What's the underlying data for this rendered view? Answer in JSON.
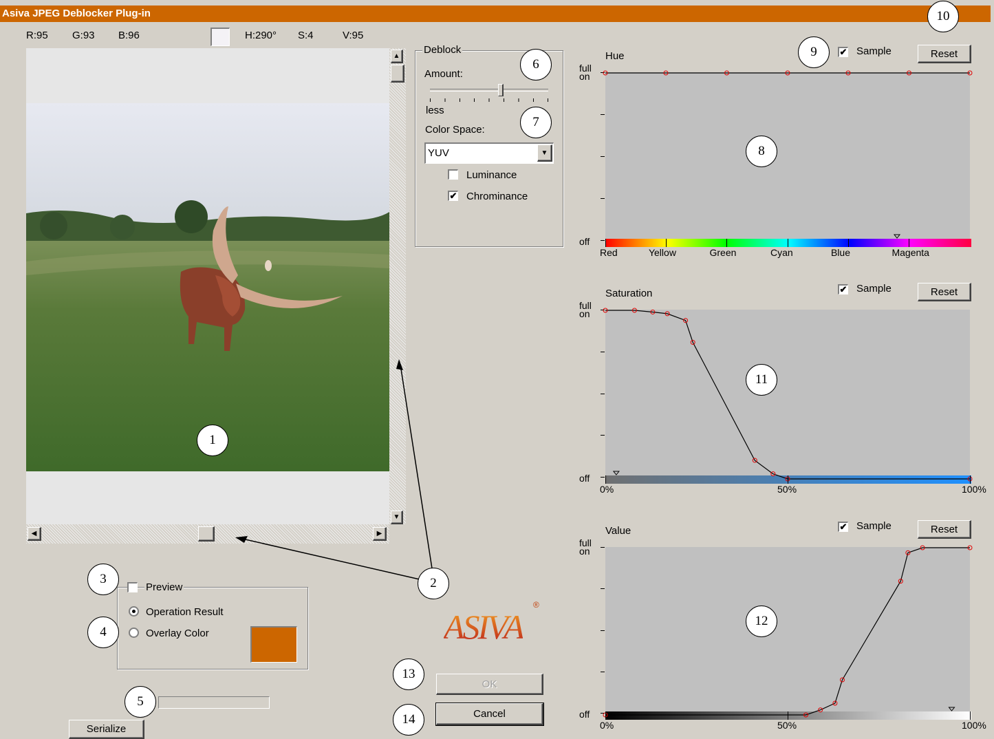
{
  "window": {
    "title": "Asiva JPEG Deblocker Plug-in"
  },
  "readout": {
    "r": "R:95",
    "g": "G:93",
    "b": "B:96",
    "h": "H:290°",
    "s": "S:4",
    "v": "V:95",
    "swatch_color": "#f4f2f6"
  },
  "deblock": {
    "group_label": "Deblock",
    "amount_label": "Amount:",
    "amount_min_label": "less",
    "amount_level": 0.6,
    "color_space_label": "Color Space:",
    "color_space_value": "YUV",
    "luminance_label": "Luminance",
    "luminance_checked": false,
    "chrominance_label": "Chrominance",
    "chrominance_checked": true
  },
  "preview": {
    "group_label": "Preview",
    "checked": false,
    "operation_result_label": "Operation Result",
    "overlay_color_label": "Overlay Color",
    "selected": "operation_result",
    "overlay_color": "#cc6600"
  },
  "buttons": {
    "serialize": "Serialize",
    "ok": "OK",
    "cancel": "Cancel"
  },
  "logo": {
    "text": "ASIVA",
    "mark": "®"
  },
  "graphs": {
    "hue": {
      "title": "Hue",
      "sample_label": "Sample",
      "sample_checked": true,
      "reset_label": "Reset",
      "y_top_label_1": "full",
      "y_top_label_2": "on",
      "y_bottom_label": "off",
      "x_labels": [
        "Red",
        "Yellow",
        "Green",
        "Cyan",
        "Blue",
        "Magenta"
      ],
      "curve": [
        [
          0,
          1
        ],
        [
          0.166,
          1
        ],
        [
          0.333,
          1
        ],
        [
          0.5,
          1
        ],
        [
          0.666,
          1
        ],
        [
          0.833,
          1
        ],
        [
          1,
          1
        ]
      ],
      "marker": 0.8
    },
    "saturation": {
      "title": "Saturation",
      "sample_label": "Sample",
      "sample_checked": true,
      "reset_label": "Reset",
      "y_top_label_1": "full",
      "y_top_label_2": "on",
      "y_bottom_label": "off",
      "x_labels": [
        "0%",
        "50%",
        "100%"
      ],
      "curve": [
        [
          0,
          1
        ],
        [
          0.08,
          1
        ],
        [
          0.13,
          0.99
        ],
        [
          0.17,
          0.98
        ],
        [
          0.22,
          0.94
        ],
        [
          0.24,
          0.81
        ],
        [
          0.41,
          0.11
        ],
        [
          0.46,
          0.03
        ],
        [
          0.5,
          0
        ],
        [
          1,
          0
        ]
      ],
      "marker": 0.03
    },
    "value": {
      "title": "Value",
      "sample_label": "Sample",
      "sample_checked": true,
      "reset_label": "Reset",
      "y_top_label_1": "full",
      "y_top_label_2": "on",
      "y_bottom_label": "off",
      "x_labels": [
        "0%",
        "50%",
        "100%"
      ],
      "curve": [
        [
          0,
          0
        ],
        [
          0.55,
          0
        ],
        [
          0.59,
          0.03
        ],
        [
          0.63,
          0.07
        ],
        [
          0.65,
          0.21
        ],
        [
          0.81,
          0.8
        ],
        [
          0.83,
          0.97
        ],
        [
          0.87,
          1
        ],
        [
          1,
          1
        ]
      ],
      "marker": 0.95
    }
  },
  "callouts": [
    "1",
    "2",
    "3",
    "4",
    "5",
    "6",
    "7",
    "8",
    "9",
    "10",
    "11",
    "12",
    "13",
    "14"
  ]
}
